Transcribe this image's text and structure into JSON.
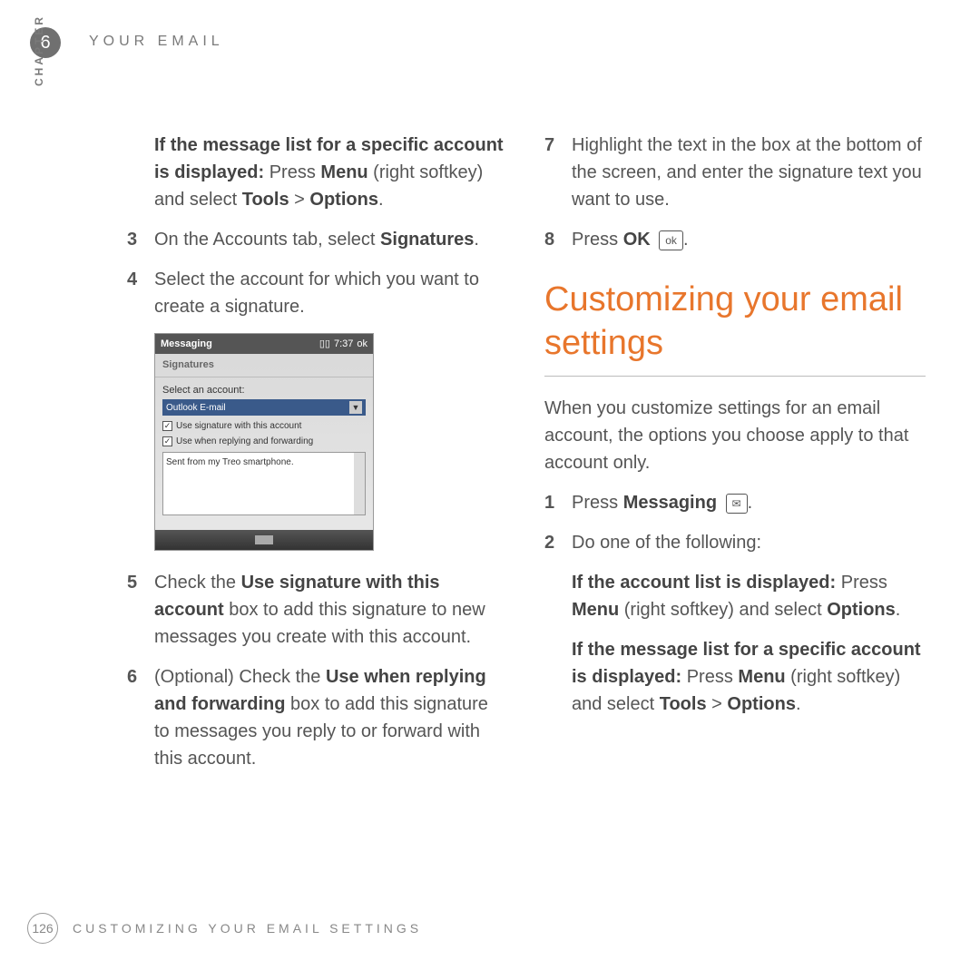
{
  "header": {
    "chapter_number": "6",
    "running_head": "YOUR EMAIL",
    "chapter_label": "CHAPTER"
  },
  "left_col": {
    "intro_bold": "If the message list for a specific account is displayed:",
    "intro_rest_1": " Press ",
    "intro_menu": "Menu",
    "intro_rest_2": " (right softkey) and select ",
    "intro_tools": "Tools",
    "intro_gt": " > ",
    "intro_options": "Options",
    "intro_period": ".",
    "step3_num": "3",
    "step3_a": "On the Accounts tab, select ",
    "step3_b": "Signatures",
    "step3_c": ".",
    "step4_num": "4",
    "step4": "Select the account for which you want to create a signature.",
    "screenshot": {
      "title": "Messaging",
      "time": "7:37",
      "ok": "ok",
      "tab": "Signatures",
      "label": "Select an account:",
      "account": "Outlook E-mail",
      "check1": "Use signature with this account",
      "check2": "Use when replying and forwarding",
      "textarea": "Sent from my Treo smartphone."
    },
    "step5_num": "5",
    "step5_a": "Check the ",
    "step5_b": "Use signature with this account",
    "step5_c": " box to add this signature to new messages you create with this account.",
    "step6_num": "6",
    "step6_a": "(Optional) Check the ",
    "step6_b": "Use when replying and forwarding",
    "step6_c": " box to add this signature to messages you reply to or forward with this account."
  },
  "right_col": {
    "step7_num": "7",
    "step7": "Highlight the text in the box at the bottom of the screen, and enter the signature text you want to use.",
    "step8_num": "8",
    "step8_a": "Press ",
    "step8_b": "OK",
    "step8_icon": "ok",
    "step8_c": ".",
    "heading": "Customizing your email settings",
    "para": "When you customize settings for an email account, the options you choose apply to that account only.",
    "r1_num": "1",
    "r1_a": "Press ",
    "r1_b": "Messaging",
    "r1_icon": "✉",
    "r1_c": ".",
    "r2_num": "2",
    "r2": "Do one of the following:",
    "r2a_bold": "If the account list is displayed:",
    "r2a_1": " Press ",
    "r2a_menu": "Menu",
    "r2a_2": " (right softkey) and select ",
    "r2a_options": "Options",
    "r2a_3": ".",
    "r2b_bold": "If the message list for a specific account is displayed:",
    "r2b_1": " Press ",
    "r2b_menu": "Menu",
    "r2b_2": " (right softkey) and select ",
    "r2b_tools": "Tools",
    "r2b_gt": " > ",
    "r2b_options": "Options",
    "r2b_3": "."
  },
  "footer": {
    "page": "126",
    "text": "CUSTOMIZING YOUR EMAIL SETTINGS"
  }
}
